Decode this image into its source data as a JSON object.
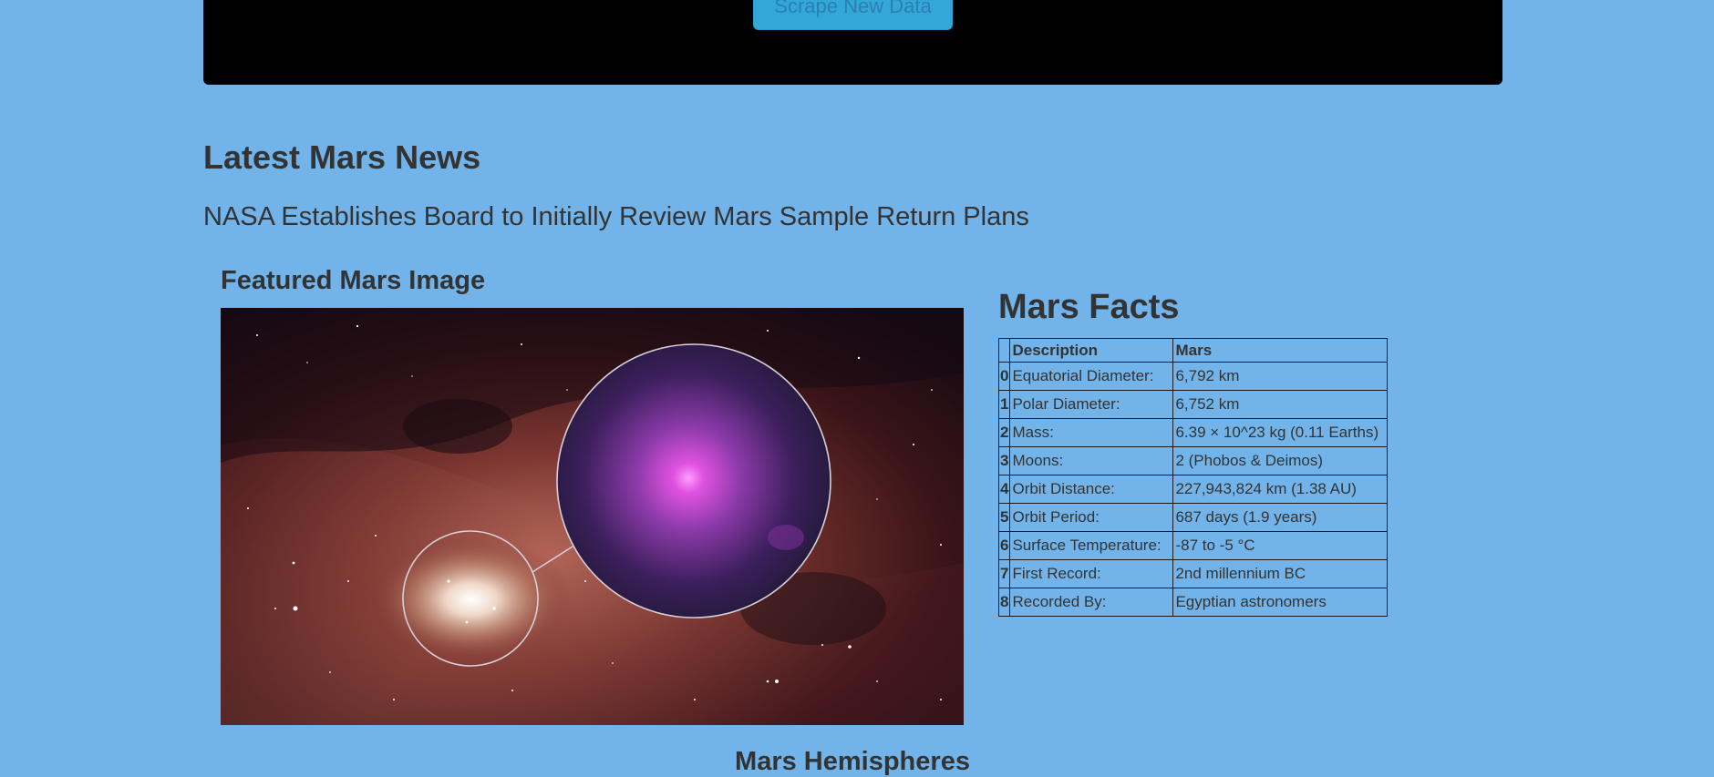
{
  "header": {
    "scrape_button_label": "Scrape New Data"
  },
  "news": {
    "heading": "Latest Mars News",
    "title": "NASA Establishes Board to Initially Review Mars Sample Return Plans"
  },
  "featured": {
    "heading": "Featured Mars Image"
  },
  "facts": {
    "heading": "Mars Facts",
    "columns": [
      "",
      "Description",
      "Mars"
    ],
    "rows": [
      {
        "index": "0",
        "description": "Equatorial Diameter:",
        "value": "6,792 km"
      },
      {
        "index": "1",
        "description": "Polar Diameter:",
        "value": "6,752 km"
      },
      {
        "index": "2",
        "description": "Mass:",
        "value": "6.39 × 10^23 kg (0.11 Earths)"
      },
      {
        "index": "3",
        "description": "Moons:",
        "value": "2 (Phobos & Deimos)"
      },
      {
        "index": "4",
        "description": "Orbit Distance:",
        "value": "227,943,824 km (1.38 AU)"
      },
      {
        "index": "5",
        "description": "Orbit Period:",
        "value": "687 days (1.9 years)"
      },
      {
        "index": "6",
        "description": "Surface Temperature:",
        "value": "-87 to -5 °C"
      },
      {
        "index": "7",
        "description": "First Record:",
        "value": "2nd millennium BC"
      },
      {
        "index": "8",
        "description": "Recorded By:",
        "value": "Egyptian astronomers"
      }
    ]
  },
  "hemispheres": {
    "heading": "Mars Hemispheres"
  },
  "colors": {
    "page_background": "#72b4ea",
    "jumbotron": "#000000",
    "button": "#34a7d9",
    "text": "#333333"
  }
}
